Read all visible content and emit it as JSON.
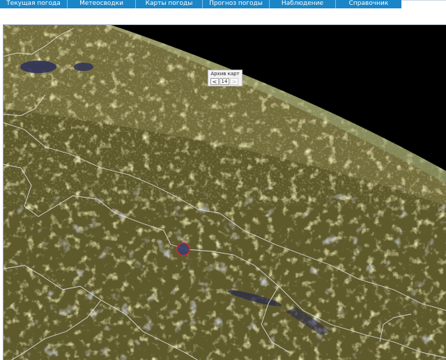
{
  "nav": {
    "items": [
      {
        "label": "Текущая погода"
      },
      {
        "label": "Метеосводки"
      },
      {
        "label": "Карты погоды"
      },
      {
        "label": "Прогноз погоды"
      },
      {
        "label": "Наблюдение"
      },
      {
        "label": "Справочник"
      }
    ]
  },
  "archive": {
    "title": "Архив карт",
    "prev_label": "<",
    "page": "14",
    "next_label": ">"
  },
  "colors": {
    "nav_bg": "#1a86c8",
    "land": "#5f5a2c",
    "cloud_yellow": "#d9d27a",
    "cloud_blue": "#b9c0e8",
    "space": "#000000",
    "border_lines": "#e8ecf4",
    "marker": "#d8262b"
  },
  "icons": [
    "volcano-marker-icon"
  ]
}
